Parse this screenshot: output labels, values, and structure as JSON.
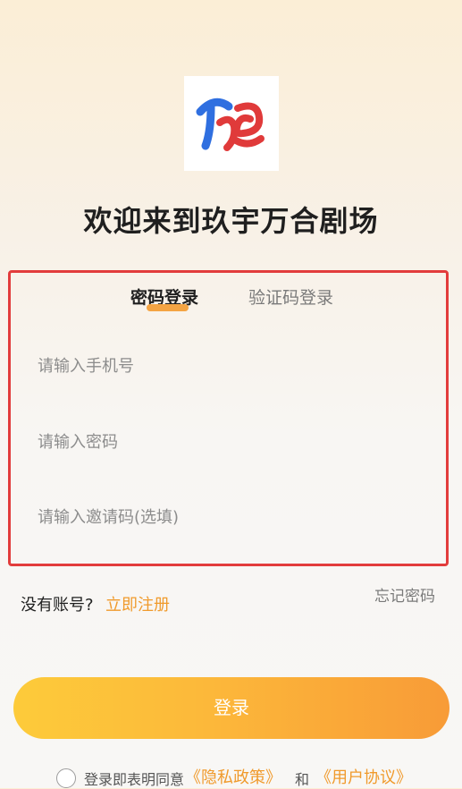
{
  "app": {
    "title": "欢迎来到玖宇万合剧场",
    "logo_text": "万合"
  },
  "tabs": {
    "password_login": "密码登录",
    "code_login": "验证码登录",
    "active": "password_login"
  },
  "form": {
    "phone_placeholder": "请输入手机号",
    "password_placeholder": "请输入密码",
    "invite_placeholder": "请输入邀请码(选填)"
  },
  "links": {
    "no_account": "没有账号?",
    "register": "立即注册",
    "forgot_password": "忘记密码"
  },
  "login_button": "登录",
  "agreement": {
    "prefix": "登录即表明同意",
    "privacy": "《隐私政策》",
    "and": "和",
    "user_agreement": "《用户协议》",
    "checked": false
  },
  "colors": {
    "accent": "#f09a2c",
    "highlight_box": "#e23c3c",
    "button_start": "#fdcb3a",
    "button_end": "#f89b37"
  }
}
